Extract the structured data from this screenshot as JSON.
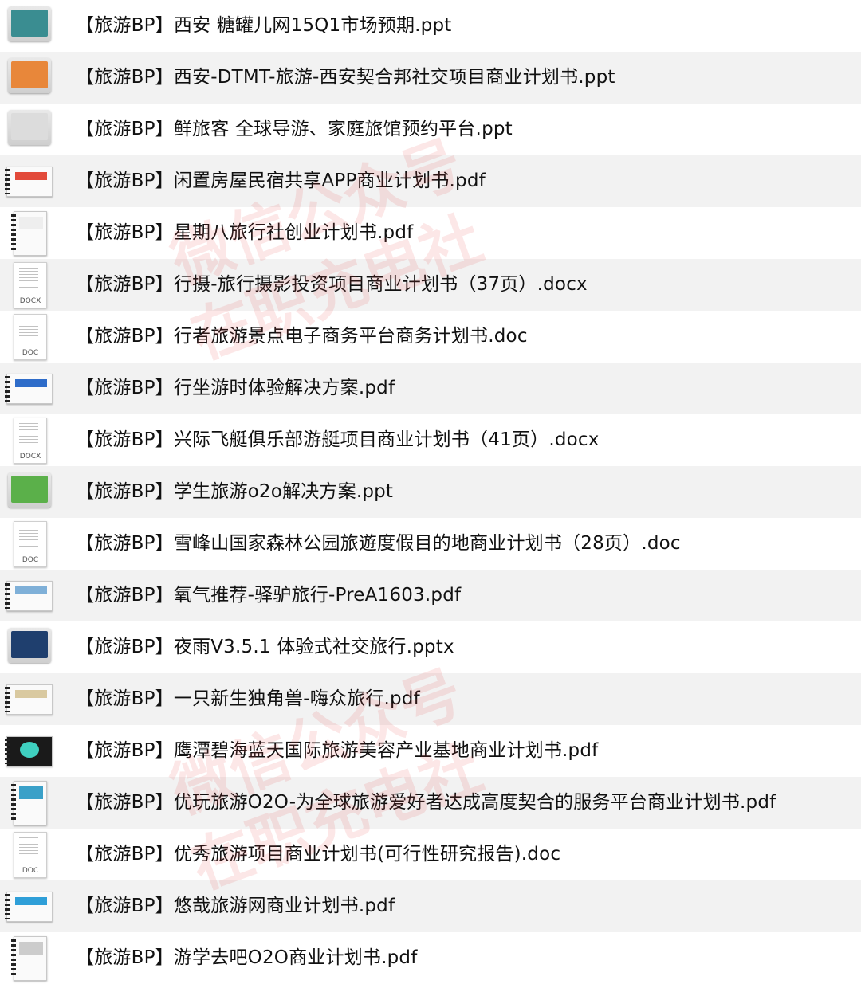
{
  "files": [
    {
      "name": "【旅游BP】西安 糖罐儿网15Q1市场预期.ppt",
      "kind": "ppt",
      "thumb": "#3a8d91"
    },
    {
      "name": "【旅游BP】西安-DTMT-旅游-西安契合邦社交项目商业计划书.ppt",
      "kind": "ppt",
      "thumb": "#e8873a"
    },
    {
      "name": "【旅游BP】鲜旅客 全球导游、家庭旅馆预约平台.ppt",
      "kind": "ppt",
      "thumb": "#dcdcdc"
    },
    {
      "name": "【旅游BP】闲置房屋民宿共享APP商业计划书.pdf",
      "kind": "pdf-landscape",
      "thumb": "#e24a3a"
    },
    {
      "name": "【旅游BP】星期八旅行社创业计划书.pdf",
      "kind": "pdf-portrait",
      "thumb": "#eeeeee"
    },
    {
      "name": "【旅游BP】行摄-旅行摄影投资项目商业计划书（37页）.docx",
      "kind": "doc",
      "tag": "DOCX"
    },
    {
      "name": "【旅游BP】行者旅游景点电子商务平台商务计划书.doc",
      "kind": "doc",
      "tag": "DOC"
    },
    {
      "name": "【旅游BP】行坐游时体验解决方案.pdf",
      "kind": "pdf-landscape",
      "thumb": "#2e6cc9"
    },
    {
      "name": "【旅游BP】兴际飞艇俱乐部游艇项目商业计划书（41页）.docx",
      "kind": "doc",
      "tag": "DOCX"
    },
    {
      "name": "【旅游BP】学生旅游o2o解决方案.ppt",
      "kind": "ppt",
      "thumb": "#5bb04a"
    },
    {
      "name": "【旅游BP】雪峰山国家森林公园旅遊度假目的地商业计划书（28页）.doc",
      "kind": "doc",
      "tag": "DOC"
    },
    {
      "name": "【旅游BP】氧气推荐-驿驴旅行-PreA1603.pdf",
      "kind": "pdf-landscape",
      "thumb": "#7fb0d8"
    },
    {
      "name": "【旅游BP】夜雨V3.5.1 体验式社交旅行.pptx",
      "kind": "ppt",
      "thumb": "#1f3f6e"
    },
    {
      "name": "【旅游BP】一只新生独角兽-嗨众旅行.pdf",
      "kind": "pdf-landscape",
      "thumb": "#d9c9a0"
    },
    {
      "name": "【旅游BP】鹰潭碧海蓝天国际旅游美容产业基地商业计划书.pdf",
      "kind": "pdf-dark",
      "thumb": "#1a1a1a"
    },
    {
      "name": "【旅游BP】优玩旅游O2O-为全球旅游爱好者达成高度契合的服务平台商业计划书.pdf",
      "kind": "pdf-portrait",
      "thumb": "#3aa0c8"
    },
    {
      "name": "【旅游BP】优秀旅游项目商业计划书(可行性研究报告).doc",
      "kind": "doc",
      "tag": "DOC"
    },
    {
      "name": "【旅游BP】悠哉旅游网商业计划书.pdf",
      "kind": "pdf-landscape",
      "thumb": "#2f9fd8"
    },
    {
      "name": "【旅游BP】游学去吧O2O商业计划书.pdf",
      "kind": "pdf-portrait",
      "thumb": "#cccccc"
    }
  ],
  "watermark": {
    "line1": "微信公众号",
    "line2": "在职充电社"
  }
}
